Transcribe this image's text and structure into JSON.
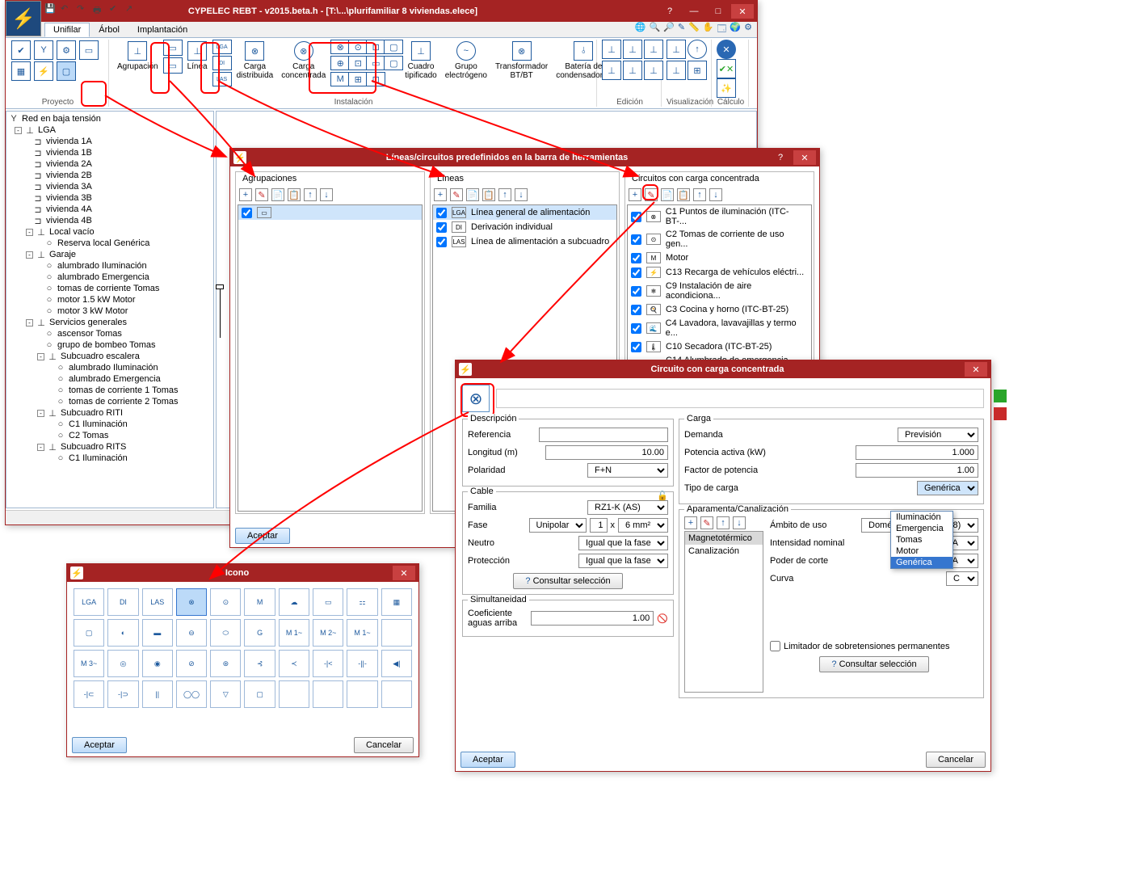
{
  "main": {
    "title": "CYPELEC REBT - v2015.beta.h - [T:\\...\\plurifamiliar 8 viviendas.elece]",
    "tabs": {
      "unifilar": "Unifilar",
      "arbol": "Árbol",
      "implantacion": "Implantación"
    },
    "ribbon": {
      "proyecto": "Proyecto",
      "instalacion": "Instalación",
      "edicion": "Edición",
      "visualizacion": "Visualización",
      "calculo": "Cálculo",
      "agrupacion": "Agrupación",
      "linea": "Línea",
      "carga_distribuida": "Carga\ndistribuida",
      "carga_concentrada": "Carga\nconcentrada",
      "cuadro_tipificado": "Cuadro\ntipificado",
      "grupo_electrogeno": "Grupo\nelectrógeno",
      "transformador": "Transformador\nBT/BT",
      "bateria_cond": "Batería de\ncondensadores"
    },
    "tree": {
      "root": "Red en baja tensión",
      "lga": "LGA",
      "viv": [
        "vivienda 1A",
        "vivienda 1B",
        "vivienda 2A",
        "vivienda 2B",
        "vivienda 3A",
        "vivienda 3B",
        "vivienda 4A",
        "vivienda 4B"
      ],
      "local": "Local vacío",
      "reserva": "Reserva local Genérica",
      "garaje": "Garaje",
      "garaje_items": [
        "alumbrado Iluminación",
        "alumbrado Emergencia",
        "tomas de corriente Tomas",
        "motor 1.5 kW Motor",
        "motor 3 kW Motor"
      ],
      "servicios": "Servicios generales",
      "serv_items": [
        "ascensor Tomas",
        "grupo de bombeo Tomas"
      ],
      "sub_esc": "Subcuadro escalera",
      "sub_esc_items": [
        "alumbrado Iluminación",
        "alumbrado Emergencia",
        "tomas de corriente 1 Tomas",
        "tomas de corriente 2 Tomas"
      ],
      "sub_riti": "Subcuadro RITI",
      "sub_riti_items": [
        "C1 Iluminación",
        "C2 Tomas"
      ],
      "sub_rits": "Subcuadro RITS",
      "sub_rits_items": [
        "C1 Iluminación"
      ]
    }
  },
  "dlg1": {
    "title": "Líneas/circuitos predefinidos en la barra de herramientas",
    "col_agr": "Agrupaciones",
    "col_lin": "Líneas",
    "col_circ": "Circuitos con carga concentrada",
    "lineas": [
      "Línea general de alimentación",
      "Derivación individual",
      "Línea de alimentación a subcuadro"
    ],
    "circuitos": [
      "C1 Puntos de iluminación (ITC-BT-...",
      "C2 Tomas de corriente de uso gen...",
      "Motor",
      "C13 Recarga de vehículos eléctri...",
      "C9 Instalación de aire acondiciona...",
      "C3 Cocina y horno (ITC-BT-25)",
      "C4 Lavadora, lavavajillas y termo e...",
      "C10 Secadora (ITC-BT-25)",
      "C14 Alumbrado de emergencia (G..."
    ],
    "aceptar": "Aceptar"
  },
  "dlg2": {
    "title": "Circuito con carga concentrada",
    "desc": {
      "legend": "Descripción",
      "ref": "Referencia",
      "long": "Longitud (m)",
      "long_val": "10.00",
      "pol": "Polaridad",
      "pol_val": "F+N"
    },
    "cable": {
      "legend": "Cable",
      "familia": "Familia",
      "familia_val": "RZ1-K (AS)",
      "fase": "Fase",
      "fase_val": "Unipolar",
      "fase_n": "1",
      "fase_x": "x",
      "fase_mm": "6 mm²",
      "neutro": "Neutro",
      "neutro_val": "Igual que la fase",
      "protec": "Protección",
      "protec_val": "Igual que la fase",
      "consultar": "Consultar selección"
    },
    "simul": {
      "legend": "Simultaneidad",
      "coef": "Coeficiente aguas arriba",
      "coef_val": "1.00"
    },
    "carga": {
      "legend": "Carga",
      "demanda": "Demanda",
      "demanda_val": "Previsión",
      "pot": "Potencia activa (kW)",
      "pot_val": "1.000",
      "fp": "Factor de potencia",
      "fp_val": "1.00",
      "tipo": "Tipo de carga",
      "tipo_val": "Genérica",
      "opts": [
        "Iluminación",
        "Emergencia",
        "Tomas",
        "Motor",
        "Genérica"
      ]
    },
    "apar": {
      "legend": "Aparamenta/Canalización",
      "items": [
        "Magnetotérmico",
        "Canalización"
      ],
      "ambito": "Ámbito de uso",
      "ambito_val": "Doméstico (IEC 60898)",
      "intn": "Intensidad nominal",
      "intn_val": "10 A",
      "poder": "Poder de corte",
      "poder_val": "6 kA",
      "curva": "Curva",
      "curva_val": "C",
      "limit": "Limitador de sobretensiones permanentes",
      "consultar": "Consultar selección"
    },
    "aceptar": "Aceptar",
    "cancelar": "Cancelar"
  },
  "dlg3": {
    "title": "Icono",
    "cells": [
      "LGA",
      "DI",
      "LAS",
      "⊗",
      "⊙",
      "M",
      "☁",
      "▭",
      "⚏",
      "▦",
      "▢",
      "◐",
      "▬",
      "⊖",
      "⬭",
      "G",
      "M\n1~",
      "M\n2~",
      "M\n1~",
      "",
      "M\n3~",
      "◎",
      "◉",
      "⊘",
      "⊛",
      "⊰",
      "≺",
      "-|<",
      "-||-",
      "◀|",
      "-|⊂",
      "-|⊃",
      "||",
      "◯◯",
      "▽",
      "▢",
      "",
      "",
      "",
      ""
    ],
    "aceptar": "Aceptar",
    "cancelar": "Cancelar"
  }
}
